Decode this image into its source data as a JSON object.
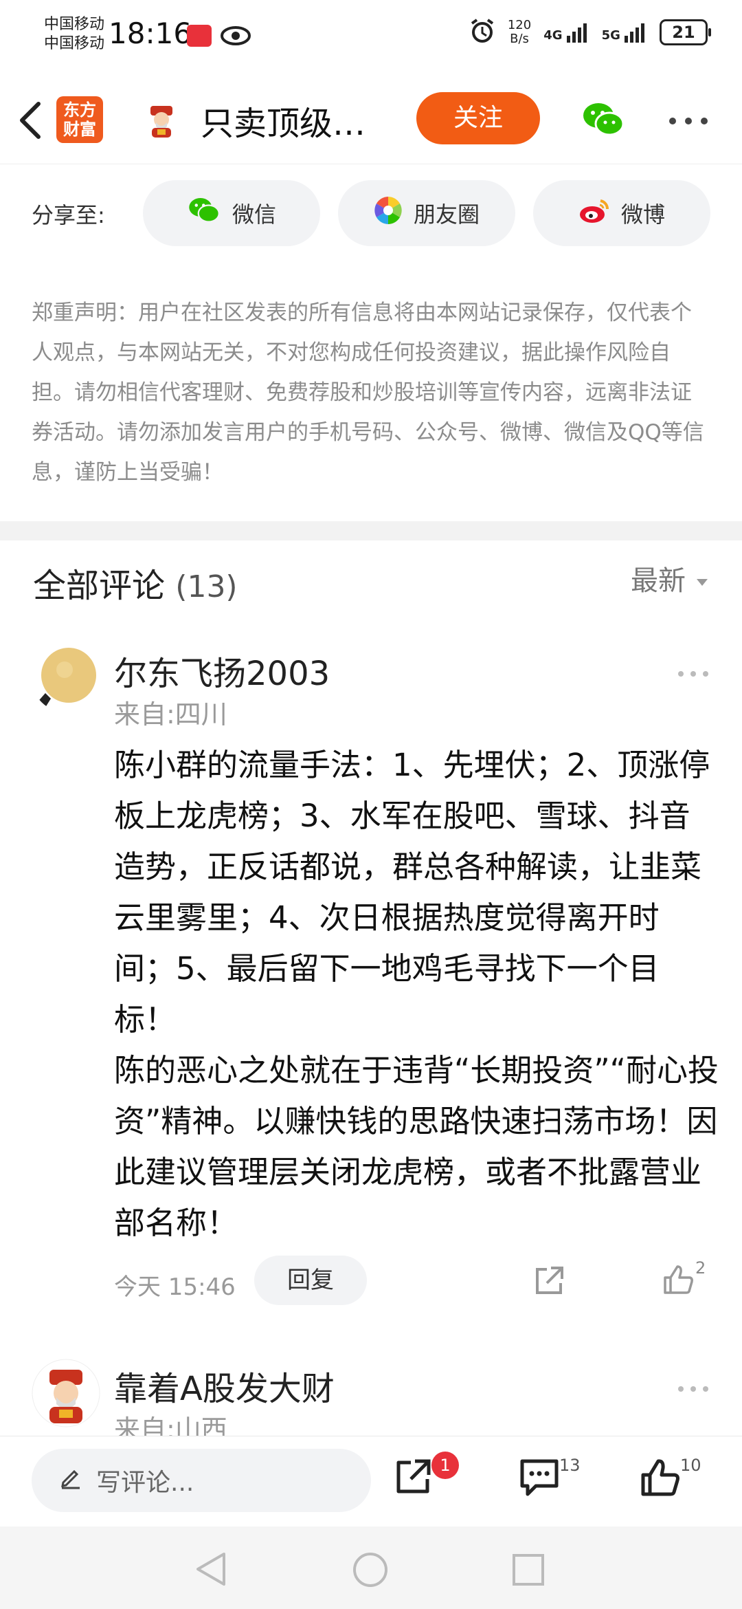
{
  "status_bar": {
    "carrier_1": "中国移动",
    "carrier_2": "中国移动",
    "time": "18:16",
    "net_speed_value": "120",
    "net_speed_unit": "B/s",
    "signal_1": "4G",
    "signal_2": "5G",
    "battery": "21"
  },
  "header": {
    "brand_line1": "东方",
    "brand_line2": "财富",
    "title": "只卖顶级…",
    "follow_label": "关注"
  },
  "share": {
    "label": "分享至:",
    "wechat": "微信",
    "moments": "朋友圈",
    "weibo": "微博"
  },
  "disclaimer": "郑重声明：用户在社区发表的所有信息将由本网站记录保存，仅代表个人观点，与本网站无关，不对您构成任何投资建议，据此操作风险自担。请勿相信代客理财、免费荐股和炒股培训等宣传内容，远离非法证券活动。请勿添加发言用户的手机号码、公众号、微博、微信及QQ等信息，谨防上当受骗！",
  "comments": {
    "title": "全部评论",
    "count": "(13)",
    "sort_label": "最新",
    "items": [
      {
        "author": "尔东飞扬2003",
        "location": "来自:四川",
        "text": "陈小群的流量手法：1、先埋伏；2、顶涨停板上龙虎榜；3、水军在股吧、雪球、抖音造势，正反话都说，群总各种解读，让韭菜云里雾里；4、次日根据热度觉得离开时间；5、最后留下一地鸡毛寻找下一个目标！\n陈的恶心之处就在于违背“长期投资”“耐心投资”精神。以赚快钱的思路快速扫荡市场！因此建议管理层关闭龙虎榜，或者不批露营业部名称！",
        "time": "今天 15:46",
        "reply_label": "回复",
        "likes": "2"
      },
      {
        "author": "靠着A股发大财",
        "location": "来自:山西"
      }
    ]
  },
  "bottom_bar": {
    "write_placeholder": "写评论...",
    "share_badge": "1",
    "comment_count": "13",
    "like_count": "10"
  },
  "colors": {
    "accent": "#f25c14",
    "brand": "#ef5a1e",
    "badge": "#e8313a",
    "wechat_green": "#2dc100",
    "muted_text": "#8c8c8c"
  }
}
